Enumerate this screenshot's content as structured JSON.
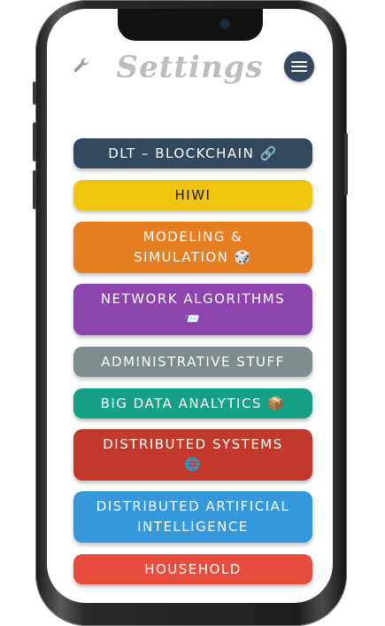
{
  "header": {
    "title": "Settings"
  },
  "icons": {
    "settings": "wrench-icon",
    "menu": "hamburger-menu-icon"
  },
  "categories": [
    {
      "line1": "DLT – BLOCKCHAIN 🔗",
      "line2": "",
      "color": "#34495e"
    },
    {
      "line1": "HIWI",
      "line2": "",
      "color": "#f1c40f",
      "text_color": "#1b1b1b"
    },
    {
      "line1": "MODELING &",
      "line2": "SIMULATION 🎲",
      "color": "#e67e22"
    },
    {
      "line1": "NETWORK ALGORITHMS",
      "line2": "📨",
      "color": "#8e44ad"
    },
    {
      "line1": "ADMINISTRATIVE STUFF",
      "line2": "",
      "color": "#7f8c8d"
    },
    {
      "line1": "BIG DATA ANALYTICS 📦",
      "line2": "",
      "color": "#16a085"
    },
    {
      "line1": "DISTRIBUTED SYSTEMS",
      "line2": "🌐",
      "color": "#c0392b"
    },
    {
      "line1": "DISTRIBUTED ARTIFICIAL",
      "line2": "INTELLIGENCE",
      "color": "#3498db"
    },
    {
      "line1": "HOUSEHOLD",
      "line2": "",
      "color": "#e74c3c"
    }
  ]
}
